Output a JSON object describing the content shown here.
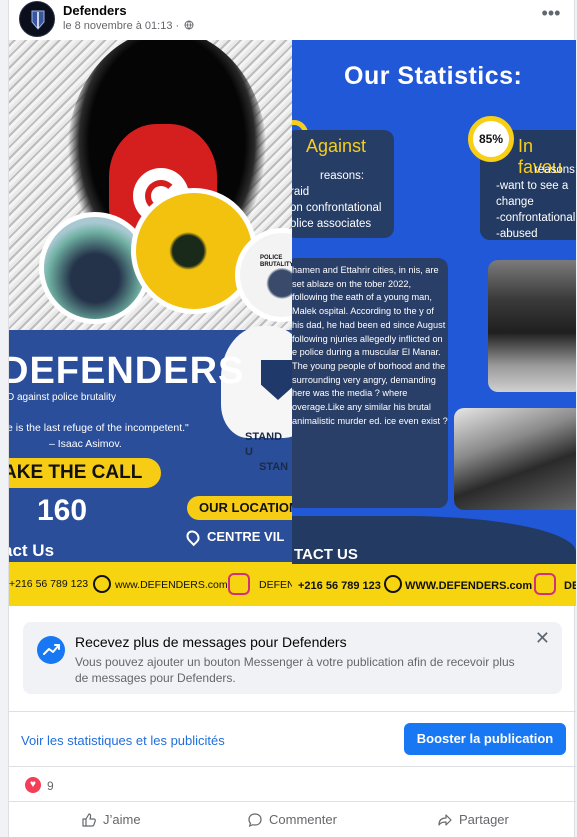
{
  "post": {
    "page_name": "Defenders",
    "timestamp": "le 8 novembre à 01:13 ·",
    "privacy_icon": "globe-icon",
    "more_icon": "ellipsis-icon"
  },
  "poster_left": {
    "logo": "DEFENDERS",
    "subtitle": "D against police brutality",
    "quote": "e is the last refuge of the incompetent.\"",
    "quote_author": "– Isaac Asimov.",
    "stand": "STAND U",
    "stand2": "STAN",
    "call_label": "AKE THE CALL",
    "phone_number": "160",
    "location_label": "OUR LOCATION",
    "location_value": "CENTRE VIL",
    "contact_label": "act Us",
    "phone": "+216 56 789 123",
    "website": "www.DEFENDERS.com",
    "social": "DEFEN",
    "badge_text": "POLICE BRUTALITY",
    "colors": {
      "blue": "#2a4e9a",
      "yellow": "#f6cc14",
      "red": "#d51f1f"
    }
  },
  "poster_right": {
    "title": "Our Statistics:",
    "percent": "85%",
    "against_label": "Against",
    "favour_label": "In favou",
    "against_reasons": [
      " reasons:",
      "raid",
      "on confrontational",
      "olice associates"
    ],
    "favour_reasons": [
      "reasons:",
      "-want to see a",
      "change",
      "-confrontational",
      "-abused"
    ],
    "story": "hamen and Ettahrir cities, in nis, are set ablaze on the tober 2022, following the eath of a young man, Malek ospital. According to the y of his dad, he had been ed since August following njuries allegedly inflicted on e police during a muscular El Manar. The young people of borhood and the surrounding very angry, demanding here was the media ? where overage.Like any similar his brutal animalistic murder ed. ice even exist ?",
    "contact_label": "TACT US",
    "phone": "+216 56 789 123",
    "website": "WWW.DEFENDERS.com",
    "social": "DEF",
    "colors": {
      "blue": "#2158d8",
      "panel": "#263d66",
      "yellow": "#f7cf17"
    }
  },
  "notice": {
    "title": "Recevez plus de messages pour Defenders",
    "body": "Vous pouvez ajouter un bouton Messenger à votre publication afin de recevoir plus de messages pour Defenders.",
    "icon": "trend-up-icon",
    "close_icon": "close-icon"
  },
  "footer": {
    "stats_link": "Voir les statistiques et les publicités",
    "boost_button": "Booster la publication",
    "reaction_icon": "heart-icon",
    "reaction_count": "9",
    "actions": [
      {
        "label": "J’aime",
        "icon": "like-icon"
      },
      {
        "label": "Commenter",
        "icon": "comment-icon"
      },
      {
        "label": "Partager",
        "icon": "share-icon"
      }
    ]
  },
  "colors": {
    "accent": "#1877f2",
    "link": "#216fdb",
    "heart": "#f33e58"
  }
}
